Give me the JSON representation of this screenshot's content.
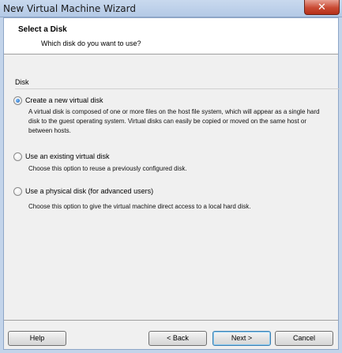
{
  "window": {
    "title": "New Virtual Machine Wizard",
    "close_glyph": "✕"
  },
  "header": {
    "title": "Select a Disk",
    "subtitle": "Which disk do you want to use?"
  },
  "group": {
    "label": "Disk"
  },
  "options": [
    {
      "label": "Create a new virtual disk",
      "description": "A virtual disk is composed of one or more files on the host file system, which will appear as a single hard disk to the guest operating system. Virtual disks can easily be copied or moved on the same host or between hosts.",
      "checked": true
    },
    {
      "label": "Use an existing virtual disk",
      "description": "Choose this option to reuse a previously configured disk.",
      "checked": false
    },
    {
      "label": "Use a physical disk (for advanced users)",
      "description": "Choose this option to give the virtual machine direct access to a local hard disk.",
      "checked": false
    }
  ],
  "buttons": {
    "help": "Help",
    "back": "< Back",
    "next": "Next >",
    "cancel": "Cancel"
  }
}
